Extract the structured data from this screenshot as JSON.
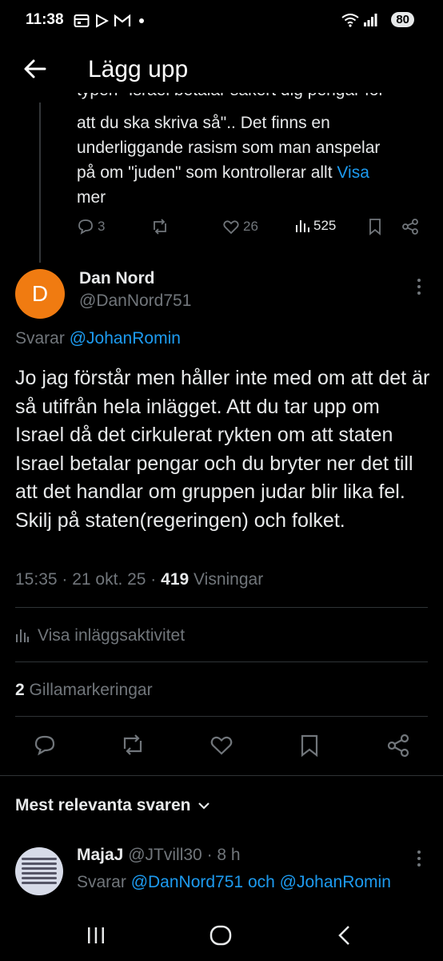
{
  "status_bar": {
    "time": "11:38",
    "battery": "80",
    "notification_icons": [
      "calendar-icon",
      "play-icon",
      "gmail-icon",
      "dot-icon"
    ],
    "right_icons": [
      "wifi-icon",
      "signal-icon"
    ]
  },
  "header": {
    "title": "Lägg upp",
    "back_icon": "arrow-left-icon"
  },
  "previous_post": {
    "lines": [
      "typen \"Israel betalar säkert dig pengar för",
      "att du ska skriva så\".. Det finns en",
      "underliggande rasism som man anspelar",
      "på om \"juden\" som kontrollerar allt"
    ],
    "show_more": "Visa",
    "show_more_2": "mer",
    "replies": "3",
    "reposts": "",
    "likes": "26",
    "views": "525"
  },
  "post": {
    "avatar_letter": "D",
    "avatar_color": "#f07b11",
    "author_name": "Dan Nord",
    "author_handle": "@DanNord751",
    "reply_prefix": "Svarar",
    "reply_to": "@JohanRomin",
    "body": "Jo jag förstår men håller inte med om att det är så utifrån hela inlägget. Att du tar upp om Israel då det cirkulerat rykten om att staten Israel betalar pengar och du bryter ner det till att det handlar om gruppen judar blir lika fel. Skilj på staten(regeringen) och folket.",
    "time": "15:35",
    "date": "21 okt. 25",
    "views_count": "419",
    "views_label": "Visningar",
    "activity_label": "Visa inläggsaktivitet",
    "likes_count": "2",
    "likes_label": "Gillamarkeringar"
  },
  "replies_section": {
    "sort_label": "Mest relevanta svaren",
    "reply": {
      "name": "MajaJ",
      "handle": "@JTvill30",
      "age": "8 h",
      "reply_prefix": "Svarar",
      "reply_to_1": "@DanNord751",
      "conjunction": "och",
      "reply_to_2": "@JohanRomin"
    }
  },
  "colors": {
    "background": "#000000",
    "text": "#e7e9ea",
    "muted": "#71767b",
    "link": "#1d9bf0",
    "divider": "#2f3336"
  }
}
